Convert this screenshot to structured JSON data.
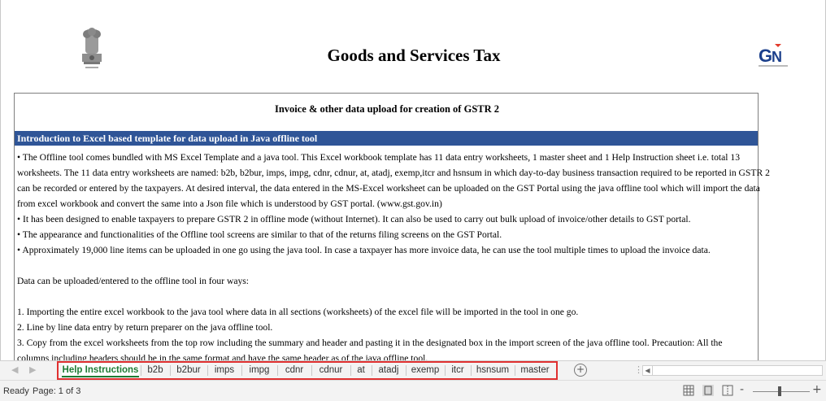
{
  "header": {
    "title": "Goods and Services Tax",
    "emblem_icon": "national-emblem-icon",
    "logo_icon": "gstn-logo-icon"
  },
  "document": {
    "subtitle": "Invoice & other  data  upload for creation of GSTR 2",
    "section_heading": "Introduction to Excel based template for data upload in Java offline  tool",
    "lines": [
      "• The Offline tool comes bundled with MS Excel Template and a java  tool. This Excel workbook template has 11 data entry worksheets, 1 master sheet and 1 Help Instruction sheet i.e. total 13",
      "worksheets. The 11 data entry worksheets are named: b2b, b2bur, imps, impg, cdnr, cdnur, at, atadj, exemp,itcr and hsnsum  in which day-to-day business transaction required to be reported in GSTR 2",
      "can be recorded or entered by the taxpayers.  At desired interval, the data entered in the MS-Excel worksheet can be uploaded on the GST Portal using the java offline tool which will import the data",
      "from excel workbook and convert the same into a Json file which is understood by GST portal. (www.gst.gov.in)",
      "•  It  has been designed to enable taxpayers to prepare GSTR 2  in  offline mode (without Internet). It can also be used to carry out bulk upload of invoice/other details to GST portal.",
      "•  The appearance and functionalities of the Offline  tool screens are similar to that  of the returns filing  screens on the GST Portal.",
      "•  Approximately 19,000 line items can be uploaded in one go using the java tool. In case a taxpayer has more invoice data, he can use the tool multiple times to upload the invoice data.",
      "",
      "Data can be uploaded/entered to the offline tool in four ways:",
      "",
      "1.  Importing the entire excel workbook to the java  tool where data in all sections (worksheets) of the excel file will be imported in the tool in one go.",
      "2.  Line by line  data entry  by return preparer on the java offline tool.",
      "3.  Copy from the  excel  worksheets from the top row  including the summary and  header  and pasting it in the designated box in the import screen of the  java offline tool.  Precaution: All the",
      "columns including headers should be in the same format  and have the same header as of the java offline tool."
    ]
  },
  "tabs": [
    {
      "label": "Help Instructions",
      "active": true
    },
    {
      "label": "b2b"
    },
    {
      "label": "b2bur"
    },
    {
      "label": "imps"
    },
    {
      "label": "impg"
    },
    {
      "label": "cdnr"
    },
    {
      "label": "cdnur"
    },
    {
      "label": "at"
    },
    {
      "label": "atadj"
    },
    {
      "label": "exemp"
    },
    {
      "label": "itcr"
    },
    {
      "label": "hsnsum"
    },
    {
      "label": "master"
    }
  ],
  "tabbar": {
    "add_sheet_label": "+",
    "dots": "⋮"
  },
  "status": {
    "ready": "Ready",
    "page": "Page: 1 of 3",
    "zoom_minus": "-",
    "zoom_plus": "+"
  },
  "colors": {
    "heading_bar": "#2f5597",
    "active_tab": "#1e7b34",
    "highlight_box": "#e03131"
  }
}
